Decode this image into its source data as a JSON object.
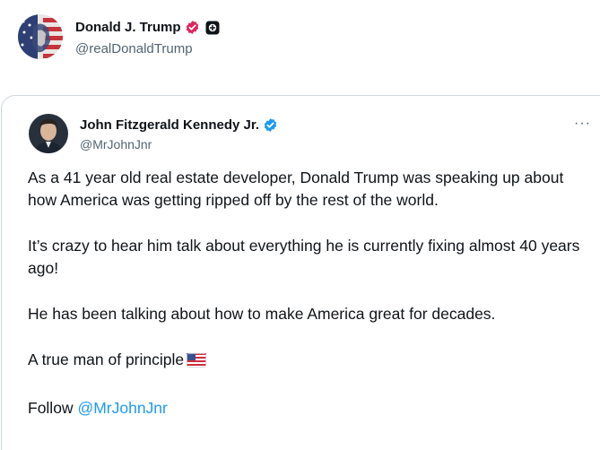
{
  "quoting_post": {
    "author_name": "Donald J. Trump",
    "author_handle": "@realDonaldTrump",
    "badges": [
      "gov-check-icon",
      "plus-square-icon"
    ]
  },
  "quoted_post": {
    "author_name": "John Fitzgerald Kennedy Jr.",
    "author_handle": "@MrJohnJnr",
    "badges": [
      "verified-check-icon"
    ],
    "more_label": "···",
    "paragraphs": [
      "As a 41 year old real estate developer, Donald Trump was speaking up about how America was getting ripped off by the rest of the world.",
      "It’s crazy to hear him talk about everything he is currently fixing almost 40 years ago!",
      "He has been talking about how to make America great for decades.",
      "A true man of principle"
    ],
    "flag_emoji": "us-flag-icon",
    "follow_prefix": "Follow ",
    "follow_mention": "@MrJohnJnr"
  },
  "colors": {
    "accent": "#1d9bf0",
    "gov_badge": "#829aab",
    "text": "#0f1419",
    "muted": "#536471",
    "border": "#cfd9de"
  }
}
